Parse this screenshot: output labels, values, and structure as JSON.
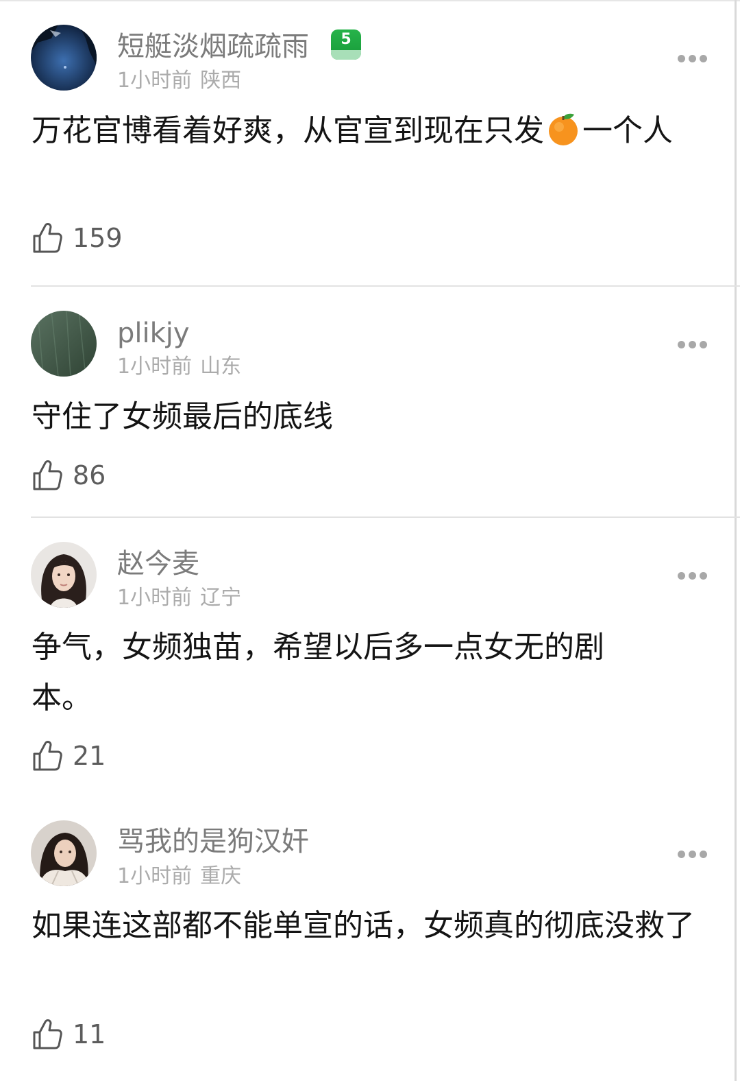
{
  "comments": [
    {
      "username": "短艇淡烟疏疏雨",
      "level": "5",
      "time": "1小时前",
      "location": "陕西",
      "content_before_emoji": "万花官博看着好爽，从官宣到现在只发",
      "emoji": "orange-emoji",
      "content_after_emoji": "一个人",
      "likes": "159"
    },
    {
      "username": "plikjy",
      "time": "1小时前",
      "location": "山东",
      "content": "守住了女频最后的底线",
      "likes": "86"
    },
    {
      "username": "赵今麦",
      "time": "1小时前",
      "location": "辽宁",
      "content": "争气，女频独苗，希望以后多一点女无的剧本。",
      "likes": "21"
    },
    {
      "username": "骂我的是狗汉奸",
      "time": "1小时前",
      "location": "重庆",
      "content": "如果连这部都不能单宣的话，女频真的彻底没救了",
      "likes": "11"
    }
  ],
  "icons": {
    "more": "more-dots-icon",
    "like": "thumbs-up-icon"
  },
  "colors": {
    "username": "#7b7b7b",
    "meta": "#ababab",
    "content": "#141414",
    "level_badge": "#1fa843"
  }
}
